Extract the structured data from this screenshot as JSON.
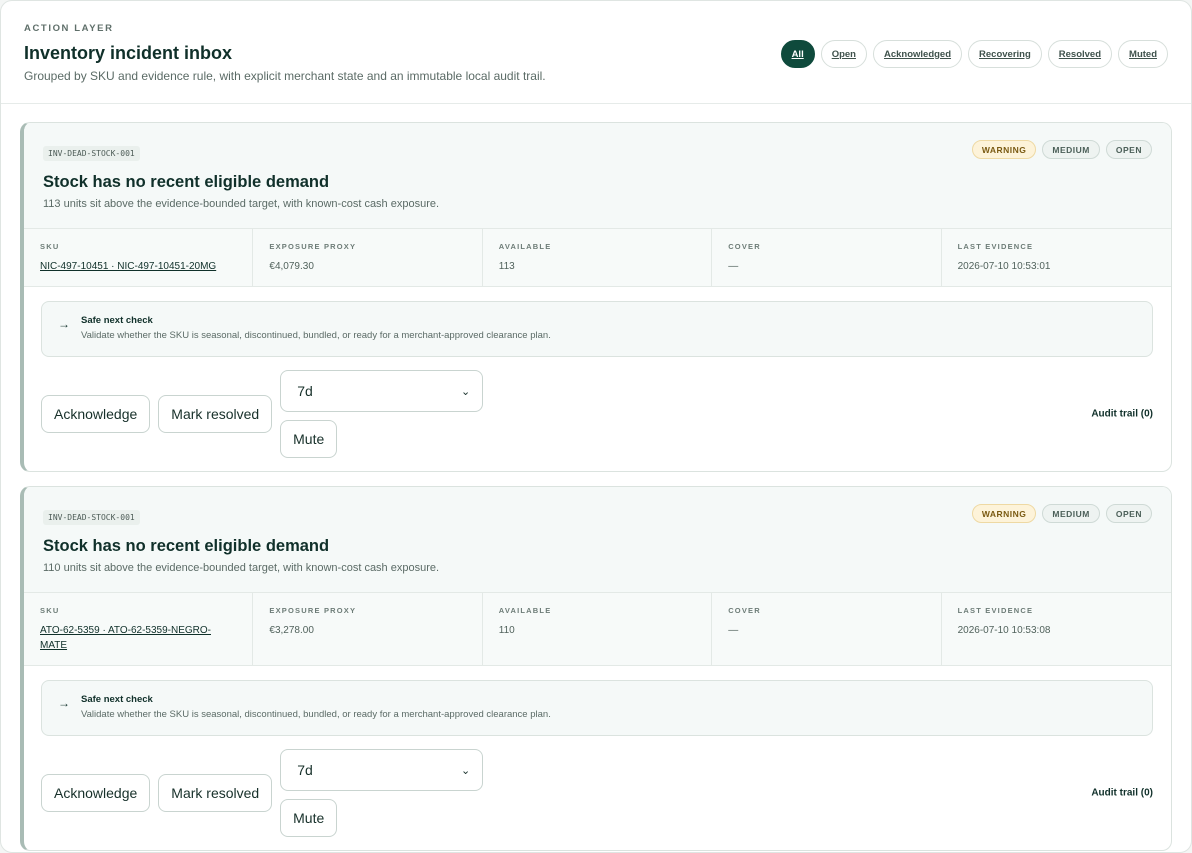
{
  "header": {
    "eyebrow": "ACTION LAYER",
    "title": "Inventory incident inbox",
    "subtitle": "Grouped by SKU and evidence rule, with explicit merchant state and an immutable local audit trail."
  },
  "filters": [
    {
      "label": "All",
      "active": true
    },
    {
      "label": "Open"
    },
    {
      "label": "Acknowledged"
    },
    {
      "label": "Recovering"
    },
    {
      "label": "Resolved"
    },
    {
      "label": "Muted"
    }
  ],
  "metric_labels": {
    "sku": "SKU",
    "exposure": "EXPOSURE PROXY",
    "available": "AVAILABLE",
    "cover": "COVER",
    "last_evidence": "LAST EVIDENCE"
  },
  "actions": {
    "acknowledge": "Acknowledge",
    "resolve": "Mark resolved",
    "mute": "Mute",
    "mute_duration": "7d"
  },
  "cards": [
    {
      "code": "INV-DEAD-STOCK-001",
      "title": "Stock has no recent eligible demand",
      "description": "113 units sit above the evidence-bounded target, with known-cost cash exposure.",
      "badges": [
        "WARNING",
        "MEDIUM",
        "OPEN"
      ],
      "sku": "NIC-497-10451 · NIC-497-10451-20MG",
      "exposure": "€4,079.30",
      "available": "113",
      "cover": "—",
      "last_evidence": "2026-07-10 10:53:01",
      "check_title": "Safe next check",
      "check_text": "Validate whether the SKU is seasonal, discontinued, bundled, or ready for a merchant-approved clearance plan.",
      "audit": "Audit trail (0)"
    },
    {
      "code": "INV-DEAD-STOCK-001",
      "title": "Stock has no recent eligible demand",
      "description": "110 units sit above the evidence-bounded target, with known-cost cash exposure.",
      "badges": [
        "WARNING",
        "MEDIUM",
        "OPEN"
      ],
      "sku": "ATO-62-5359 · ATO-62-5359-NEGRO-MATE",
      "exposure": "€3,278.00",
      "available": "110",
      "cover": "—",
      "last_evidence": "2026-07-10 10:53:08",
      "check_title": "Safe next check",
      "check_text": "Validate whether the SKU is seasonal, discontinued, bundled, or ready for a merchant-approved clearance plan.",
      "audit": "Audit trail (0)"
    }
  ],
  "colors": {
    "accent": "#0f4a3c",
    "warning_bg": "#fdf3d9",
    "card_border_left": "#a9bcb5"
  },
  "icons": {
    "next_check": "arrow-right-icon",
    "select": "chevron-down-icon"
  }
}
